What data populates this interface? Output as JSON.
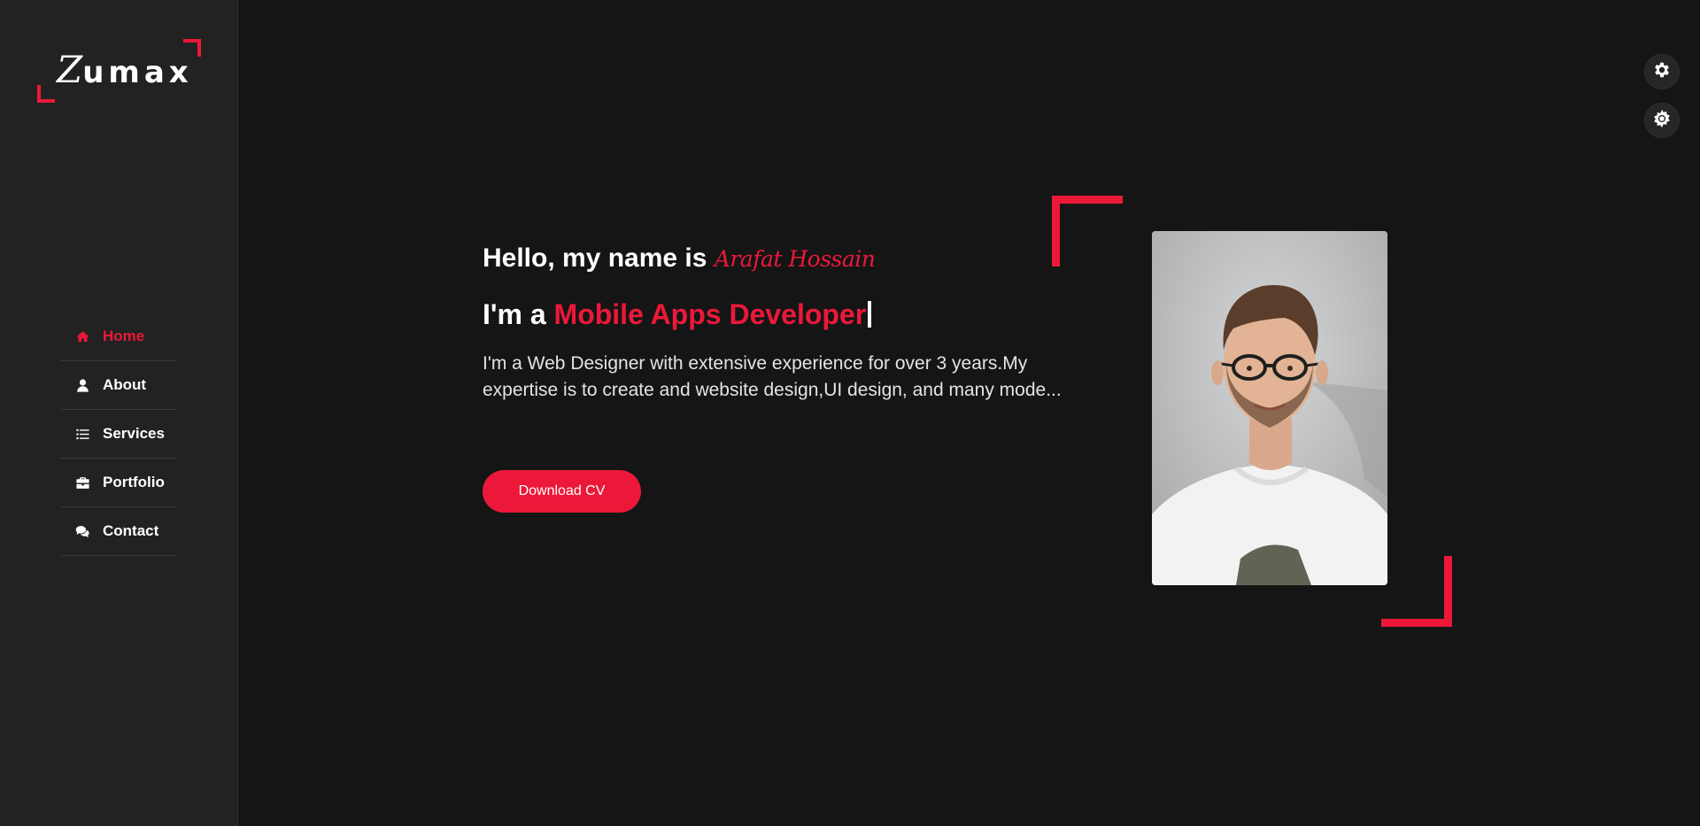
{
  "brand": {
    "logo_first": "Z",
    "logo_rest": "umax"
  },
  "colors": {
    "accent": "#ec1839",
    "background": "#151515",
    "sidebar": "#222222"
  },
  "nav": {
    "items": [
      {
        "label": "Home",
        "icon": "home-icon",
        "active": true
      },
      {
        "label": "About",
        "icon": "user-icon",
        "active": false
      },
      {
        "label": "Services",
        "icon": "list-icon",
        "active": false
      },
      {
        "label": "Portfolio",
        "icon": "briefcase-icon",
        "active": false
      },
      {
        "label": "Contact",
        "icon": "comments-icon",
        "active": false
      }
    ]
  },
  "settings": {
    "icons": [
      "gear-icon",
      "sun-icon"
    ]
  },
  "hero": {
    "greeting": "Hello, my name is",
    "name": "Arafat Hossain",
    "role_prefix": "I'm a",
    "role": "Mobile Apps Developer",
    "description": "I'm a Web Designer with extensive experience for over 3 years.My expertise is to create and website design,UI design, and many mode...",
    "button_label": "Download CV"
  }
}
